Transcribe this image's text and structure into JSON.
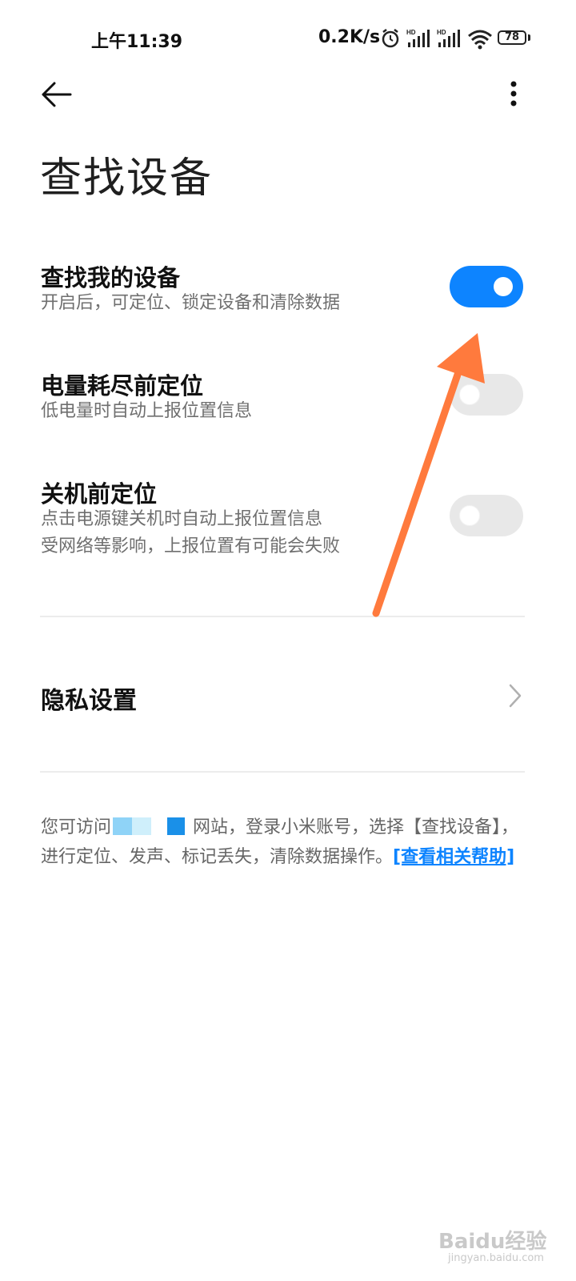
{
  "status_bar": {
    "time": "上午11:39",
    "net_speed": "0.2K/s",
    "battery": "78",
    "icons": [
      "alarm-icon",
      "hd-signal-icon",
      "hd-signal-icon",
      "wifi-icon"
    ]
  },
  "toolbar": {
    "back_icon": "back-arrow-icon",
    "more_icon": "more-vertical-icon"
  },
  "page": {
    "title": "查找设备"
  },
  "settings": [
    {
      "title": "查找我的设备",
      "subtitle": "开启后，可定位、锁定设备和清除数据",
      "enabled": true
    },
    {
      "title": "电量耗尽前定位",
      "subtitle": "低电量时自动上报位置信息",
      "enabled": false
    },
    {
      "title": "关机前定位",
      "subtitle_line1": "点击电源键关机时自动上报位置信息",
      "subtitle_line2": "受网络等影响，上报位置有可能会失败",
      "enabled": false
    }
  ],
  "privacy": {
    "label": "隐私设置",
    "icon": "chevron-right-icon"
  },
  "note": {
    "part1": "您可访问",
    "part2": "网站，登录小米账号，选择【查找设备】，进行定位、发声、标记丢失，清除数据操作。",
    "link": "[查看相关帮助]"
  },
  "watermark": {
    "main": "Baidu经验",
    "sub": "jingyan.baidu.com"
  },
  "colors": {
    "accent": "#0d84ff",
    "toggle_off": "#e8e8e8",
    "annotation_arrow": "#ff7a3d"
  }
}
